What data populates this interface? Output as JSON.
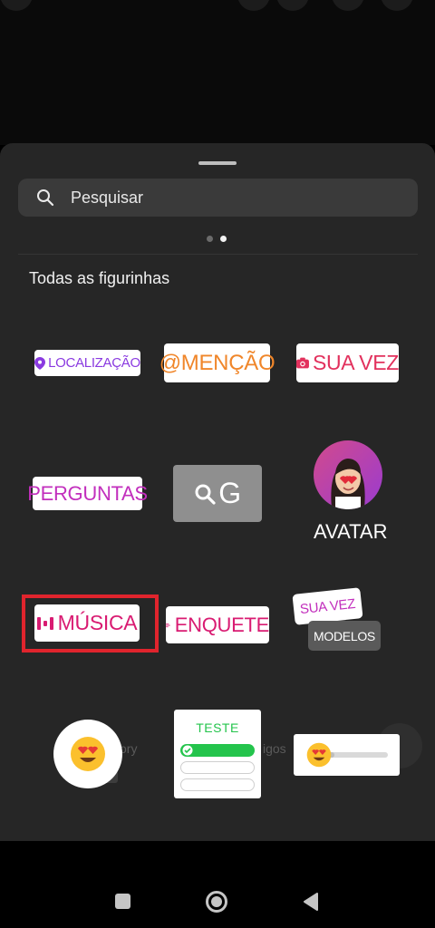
{
  "sheet": {
    "search_placeholder": "Pesquisar",
    "section_title": "Todas as figurinhas",
    "page_count": 2,
    "active_page": 2
  },
  "stickers": {
    "location": "LOCALIZAÇÃO",
    "mention": "@MENÇÃO",
    "your_turn": "SUA VEZ",
    "questions": "PERGUNTAS",
    "gif": "G",
    "avatar": "AVATAR",
    "music": "MÚSICA",
    "poll": "ENQUETE",
    "templates_top": "SUA VEZ",
    "templates_bottom": "MODELOS",
    "quiz_title": "TESTE",
    "emoji_slider_level": 0.1
  },
  "background_text": {
    "left": "ory",
    "right": "igos"
  },
  "colors": {
    "sheet_bg": "#262626",
    "location": "#8a3ae0",
    "mention": "#f0862a",
    "your_turn": "#e2315d",
    "questions": "#c22fbd",
    "music": "#d91b72",
    "poll": "#d91b72",
    "quiz_green": "#24c44c",
    "highlight_red": "#e0242d"
  },
  "nav": {
    "recents_icon": "square-icon",
    "home_icon": "circle-home-icon",
    "back_icon": "triangle-back-icon"
  }
}
